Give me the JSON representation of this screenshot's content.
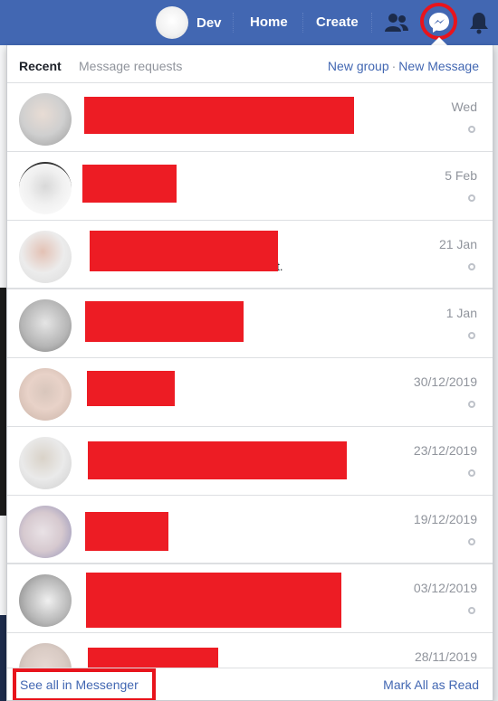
{
  "navbar": {
    "profile_name": "Dev",
    "links": [
      "Home",
      "Create"
    ],
    "icons": [
      "friend-requests-icon",
      "messenger-icon",
      "notifications-icon"
    ],
    "brand_color": "#4267b2",
    "highlight_color": "#e8141c"
  },
  "dropdown": {
    "tabs": {
      "recent": "Recent",
      "requests": "Message requests"
    },
    "actions": {
      "new_group": "New group",
      "separator": "·",
      "new_message": "New Message"
    },
    "conversations": [
      {
        "date": "Wed",
        "snippet": ""
      },
      {
        "date": "5 Feb",
        "snippet": ""
      },
      {
        "date": "21 Jan",
        "snippet": "nt."
      },
      {
        "date": "1 Jan",
        "snippet": ""
      },
      {
        "date": "30/12/2019",
        "snippet": ""
      },
      {
        "date": "23/12/2019",
        "snippet": ""
      },
      {
        "date": "19/12/2019",
        "snippet": ""
      },
      {
        "date": "03/12/2019",
        "snippet": ""
      },
      {
        "date": "28/11/2019",
        "snippet": ""
      }
    ],
    "footer": {
      "see_all": "See all in Messenger",
      "mark_all_read": "Mark All as Read"
    }
  }
}
